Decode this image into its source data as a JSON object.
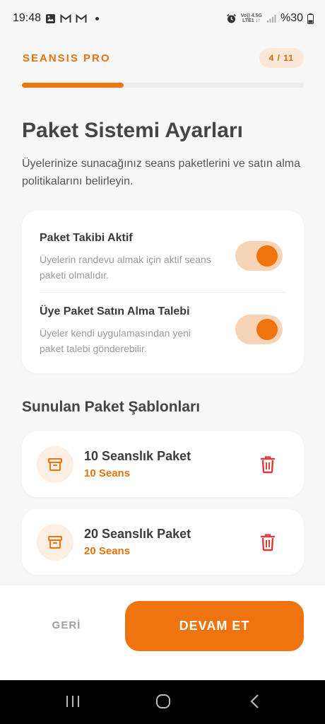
{
  "status_bar": {
    "time": "19:48",
    "net_top": "Vo)) 4.5G",
    "net_bottom": "LTE1 ↓↑",
    "battery": "%30"
  },
  "header": {
    "brand": "SEANSIS PRO",
    "step": "4 / 11",
    "progress": 0.36
  },
  "page": {
    "title": "Paket Sistemi Ayarları",
    "subtitle": "Üyelerinize sunacağınız seans paketlerini ve satın alma politikalarını belirleyin."
  },
  "settings": [
    {
      "title": "Paket Takibi Aktif",
      "description": "Üyelerin randevu almak için aktif seans paketi olmalıdır.",
      "enabled": true
    },
    {
      "title": "Üye Paket Satın Alma Talebi",
      "description": "Üyeler kendi uygulamasından yeni paket talebi gönderebilir.",
      "enabled": true
    }
  ],
  "packages_section": {
    "title": "Sunulan Paket Şablonları",
    "items": [
      {
        "name": "10 Seanslık Paket",
        "count": "10 Seans",
        "icon": "archive-icon"
      },
      {
        "name": "20 Seanslık Paket",
        "count": "20 Seans",
        "icon": "archive-icon"
      }
    ]
  },
  "footer": {
    "back_label": "GERİ",
    "continue_label": "DEVAM ET"
  },
  "colors": {
    "accent": "#ef7410",
    "accent_light": "#f8d4b6",
    "delete": "#e03a3a"
  }
}
